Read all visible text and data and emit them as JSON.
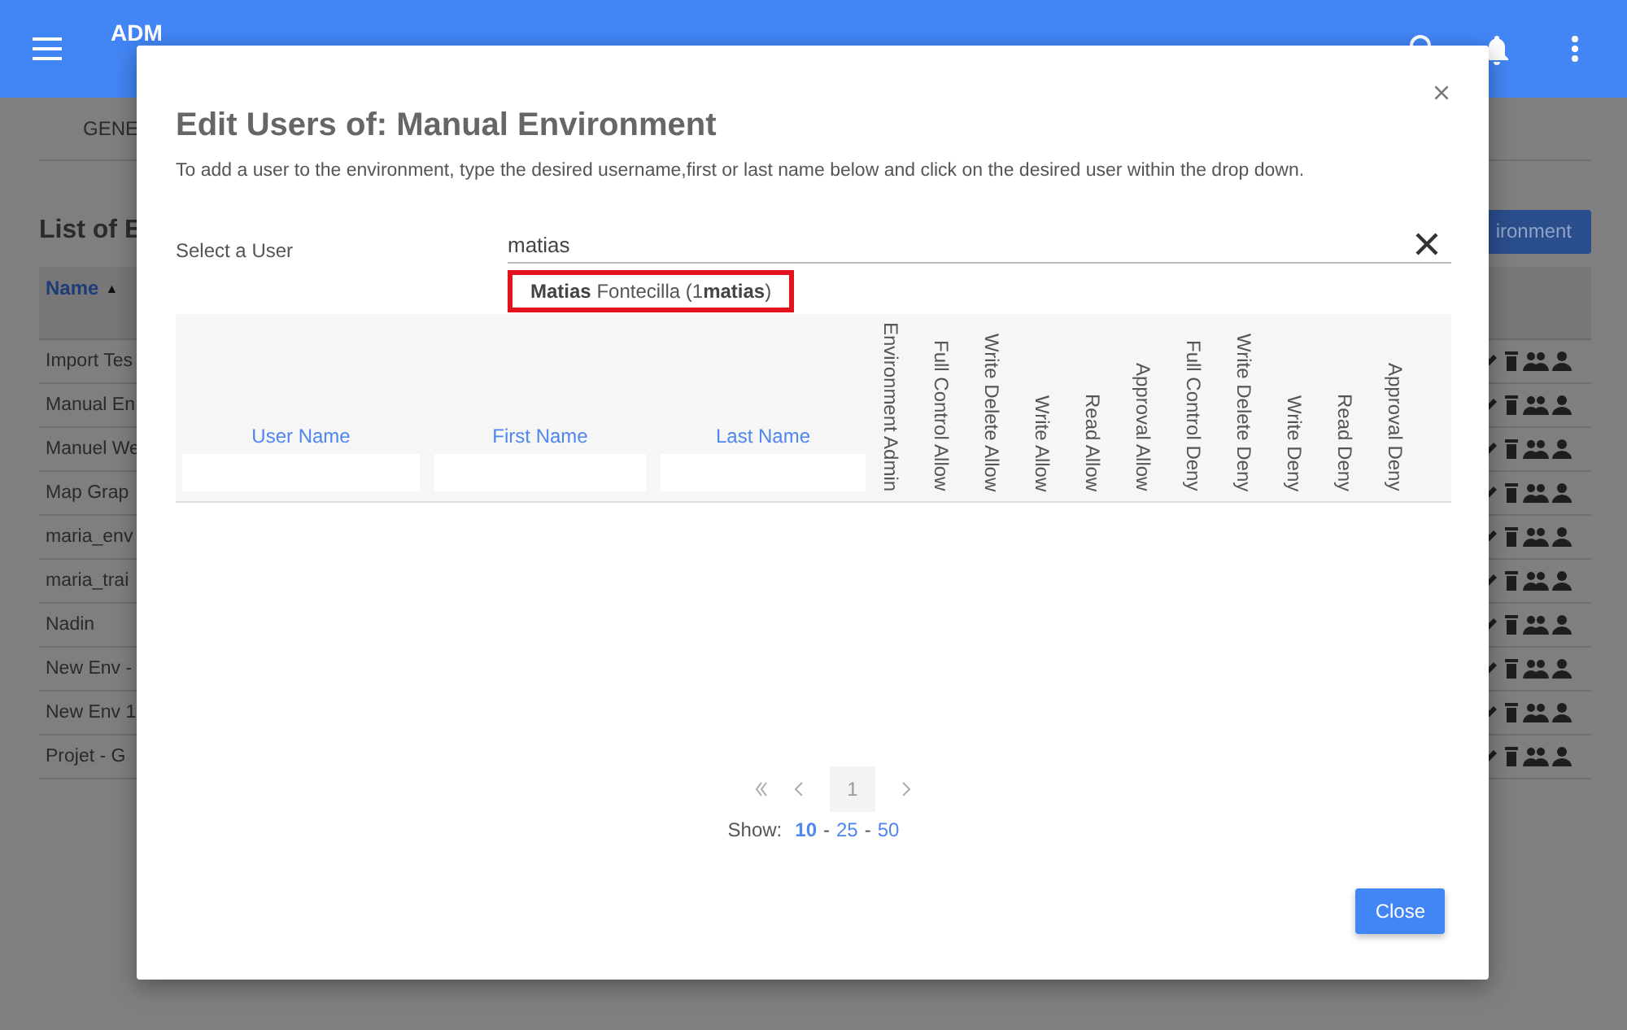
{
  "app_bar": {
    "title": "ADM"
  },
  "page": {
    "tab": "GENE",
    "heading": "List of E",
    "add_button": "ironment",
    "table": {
      "columns": [
        {
          "label": "Name",
          "sort_glyph": "▲"
        }
      ],
      "rows": [
        {
          "name": "Import Tes"
        },
        {
          "name": "Manual En"
        },
        {
          "name": "Manuel We"
        },
        {
          "name": "Map Grap"
        },
        {
          "name": "maria_env"
        },
        {
          "name": "maria_trai"
        },
        {
          "name": "Nadin"
        },
        {
          "name": "New Env -"
        },
        {
          "name": "New Env 1"
        },
        {
          "name": "Projet - G"
        }
      ]
    }
  },
  "dialog": {
    "title": "Edit Users of: Manual Environment",
    "description": "To add a user to the environment, type the desired username,first or last name below and click on the desired user within the drop down.",
    "select_label": "Select a User",
    "search": {
      "value": "matias"
    },
    "suggestions": [
      {
        "text": "**Matias** Fontecilla (1**matias**)",
        "highlighted": true
      }
    ],
    "columns": [
      {
        "label": "User Name",
        "kind": "filter"
      },
      {
        "label": "First Name",
        "kind": "filter"
      },
      {
        "label": "Last Name",
        "kind": "filter"
      },
      {
        "label": "Environment Admin",
        "kind": "permission"
      },
      {
        "label": "Full Control Allow",
        "kind": "permission"
      },
      {
        "label": "Write Delete Allow",
        "kind": "permission"
      },
      {
        "label": "Write Allow",
        "kind": "permission"
      },
      {
        "label": "Read Allow",
        "kind": "permission"
      },
      {
        "label": "Approval Allow",
        "kind": "permission"
      },
      {
        "label": "Full Control Deny",
        "kind": "permission"
      },
      {
        "label": "Write Delete Deny",
        "kind": "permission"
      },
      {
        "label": "Write Deny",
        "kind": "permission"
      },
      {
        "label": "Read Deny",
        "kind": "permission"
      },
      {
        "label": "Approval Deny",
        "kind": "permission"
      }
    ],
    "pagination": {
      "pages": [
        {
          "label": "1",
          "selected": true
        }
      ]
    },
    "page_size": {
      "label": "Show:",
      "separator": "-",
      "options": [
        {
          "label": "10",
          "selected": true
        },
        {
          "label": "25",
          "selected": false
        },
        {
          "label": "50",
          "selected": false
        }
      ]
    },
    "close_button": "Close"
  }
}
